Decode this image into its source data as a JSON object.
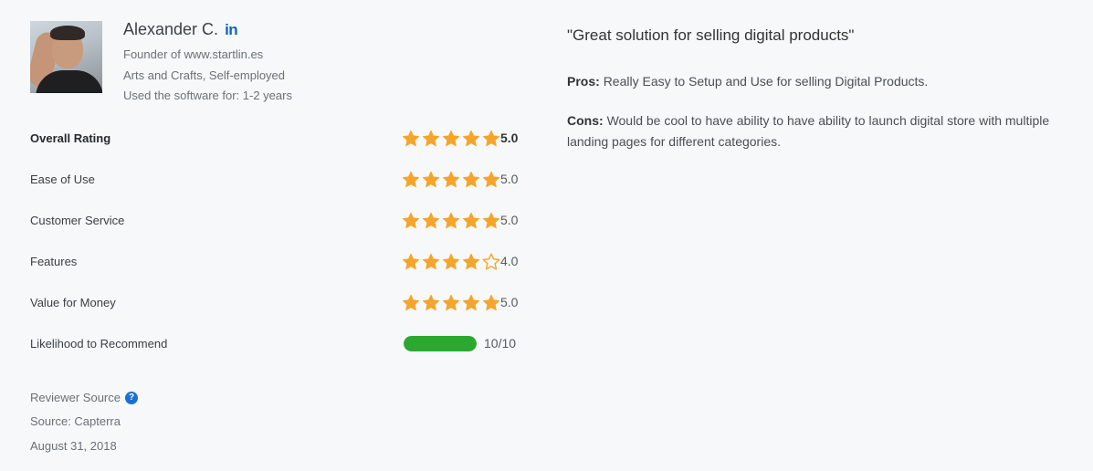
{
  "reviewer": {
    "name": "Alexander C.",
    "linkedin_icon": "linkedin-icon",
    "linkedin_text": "in",
    "title": "Founder of www.startlin.es",
    "industry": "Arts and Crafts, Self-employed",
    "usage": "Used the software for: 1-2 years"
  },
  "ratings": [
    {
      "label": "Overall Rating",
      "stars": 5,
      "value": "5.0"
    },
    {
      "label": "Ease of Use",
      "stars": 5,
      "value": "5.0"
    },
    {
      "label": "Customer Service",
      "stars": 5,
      "value": "5.0"
    },
    {
      "label": "Features",
      "stars": 4,
      "value": "4.0"
    },
    {
      "label": "Value for Money",
      "stars": 5,
      "value": "5.0"
    }
  ],
  "recommend": {
    "label": "Likelihood to Recommend",
    "fraction": 1.0,
    "value": "10/10"
  },
  "source": {
    "reviewer_source_label": "Reviewer Source",
    "help_icon": "question-circle-icon",
    "help_glyph": "?",
    "source_text": "Source: Capterra",
    "date": "August 31, 2018"
  },
  "review": {
    "title": "\"Great solution for selling digital products\"",
    "pros_label": "Pros:",
    "pros_text": "Really Easy to Setup and Use for selling Digital Products.",
    "cons_label": "Cons:",
    "cons_text": "Would be cool to have ability to have ability to launch digital store with multiple landing pages for different categories."
  },
  "colors": {
    "star": "#f5a52a",
    "bar_fill": "#2aa82f",
    "linkedin": "#0a66c2",
    "help_icon": "#1c6fd3"
  }
}
